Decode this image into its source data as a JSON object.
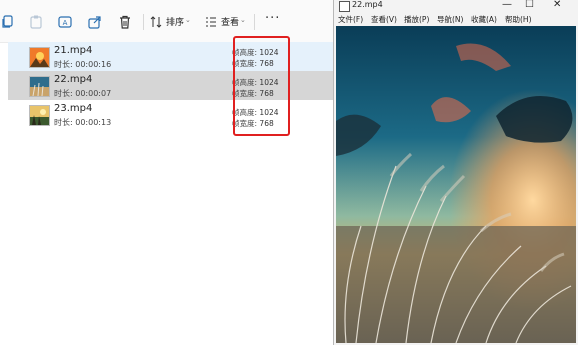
{
  "toolbar": {
    "sort_label": "排序",
    "view_label": "查看",
    "more_label": "···"
  },
  "files": [
    {
      "name": "21.mp4",
      "duration_label": "时长:",
      "duration": "00:00:16",
      "height_label": "帧高度:",
      "height": "1024",
      "width_label": "帧宽度:",
      "width": "768"
    },
    {
      "name": "22.mp4",
      "duration_label": "时长:",
      "duration": "00:00:07",
      "height_label": "帧高度:",
      "height": "1024",
      "width_label": "帧宽度:",
      "width": "768"
    },
    {
      "name": "23.mp4",
      "duration_label": "时长:",
      "duration": "00:00:13",
      "height_label": "帧高度:",
      "height": "1024",
      "width_label": "帧宽度:",
      "width": "768"
    }
  ],
  "player": {
    "title": "22.mp4",
    "minimize": "—",
    "maximize": "☐",
    "close": "✕",
    "menu": [
      "文件(F)",
      "查看(V)",
      "播放(P)",
      "导航(N)",
      "收藏(A)",
      "帮助(H)"
    ]
  },
  "colors": {
    "highlight": "#e5f1fb",
    "selected_row": "#d6d6d6",
    "annotation_box": "#e02020"
  }
}
